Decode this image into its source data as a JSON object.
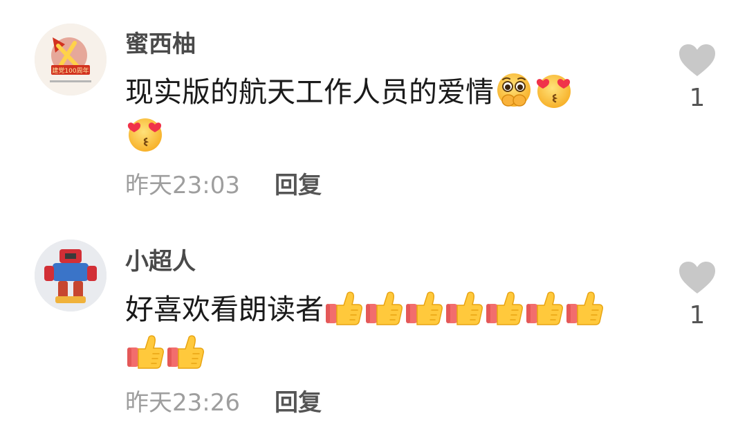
{
  "comments": [
    {
      "username": "蜜西柚",
      "text": "现实版的航天工作人员的爱情",
      "emojis": [
        "pleading-face-hands",
        "face-blowing-kiss",
        "face-blowing-kiss"
      ],
      "time": "昨天23:03",
      "reply_label": "回复",
      "like_count": "1",
      "avatar_badge_text": "建党100周年"
    },
    {
      "username": "小超人",
      "text": "好喜欢看朗读者",
      "emojis": [
        "thumbs-up",
        "thumbs-up",
        "thumbs-up",
        "thumbs-up",
        "thumbs-up",
        "thumbs-up",
        "thumbs-up",
        "thumbs-up",
        "thumbs-up"
      ],
      "time": "昨天23:26",
      "reply_label": "回复",
      "like_count": "1"
    }
  ],
  "colors": {
    "username": "#4a4a4a",
    "text": "#1a1a1a",
    "time": "#9e9e9e",
    "reply": "#555555",
    "heart": "#c8c8c8",
    "emoji_yellow": "#ffc93c",
    "emoji_heart": "#f0334a",
    "thumb_cuff": "#f26d6d"
  }
}
